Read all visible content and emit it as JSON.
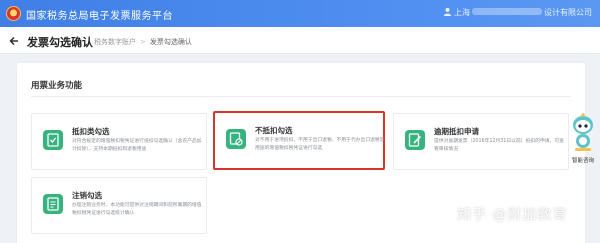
{
  "header": {
    "app_title": "国家税务总局电子发票服务平台",
    "user_prefix": "上海",
    "user_suffix": "设计有限公司"
  },
  "subheader": {
    "page_title": "发票勾选确认",
    "breadcrumb": [
      "税务数字账户",
      "发票勾选确认"
    ]
  },
  "section": {
    "title": "用票业务功能"
  },
  "cards": [
    {
      "title": "抵扣类勾选",
      "desc": "对符合规定的增值税扣税凭证进行抵扣勾选确认（含农产品加计扣除），支持本期抵扣和退税用途"
    },
    {
      "title": "不抵扣勾选",
      "desc": "对不用于进项抵扣、不用于出口退税、不用于代办出口退税等用途的增值税扣税凭证进行勾选"
    },
    {
      "title": "逾期抵扣申请",
      "desc": "提供对逾期发票（2016年12月31日以前）抵扣的申请，可查看审核情况"
    },
    {
      "title": "注销勾选",
      "desc": "办理注销业务时，本功能可提供对注销期间和前所属期的增值税扣税凭证进行勾选统计确认"
    }
  ],
  "assistant": {
    "label": "智能咨询"
  },
  "watermark": "知乎 @财加教育",
  "colors": {
    "topbar": "#3f7fe6",
    "icon_green": "#36b37e",
    "selected_border": "#d9342b"
  }
}
